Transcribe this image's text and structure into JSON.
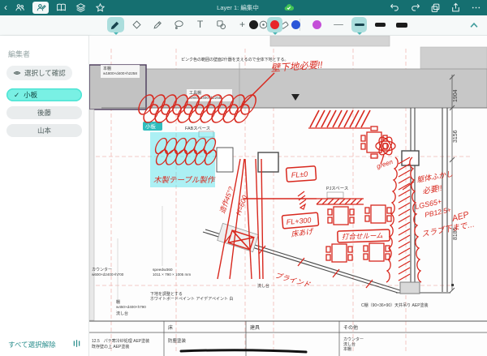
{
  "topbar": {
    "back": "‹",
    "title": "Layer 1: 編集中",
    "icons": [
      "collaborators",
      "editor-mode",
      "notebook",
      "layers",
      "favorite",
      "sync-ok",
      "undo",
      "redo",
      "duplicate",
      "export",
      "more"
    ]
  },
  "toolbar": {
    "tools": [
      "pen",
      "marker",
      "pencil",
      "lasso",
      "text",
      "shape",
      "add",
      "precision",
      "eraser"
    ],
    "selected_tool": "pen",
    "text_tool_label": "T",
    "plus_tool_label": "+",
    "colors": [
      "#1c1c1c",
      "#e8262a",
      "#2b56d8",
      "#c44fd8"
    ],
    "selected_color": "#e8262a",
    "stroke_widths_px": [
      2,
      3,
      5,
      7
    ],
    "selected_stroke_index": 1,
    "accent": "#156f70",
    "highlight_cyan": "#49e0e8"
  },
  "sidebar": {
    "header": "編集者",
    "confirm_button": "選択して確認",
    "members": [
      {
        "name": "小板",
        "selected": true,
        "check": "✓"
      },
      {
        "name": "後藤",
        "selected": false
      },
      {
        "name": "山本",
        "selected": false
      }
    ],
    "deselect_all": "すべて選択解除"
  },
  "canvas": {
    "editor_tag": "小板",
    "dims": {
      "d1": "1904",
      "d2": "3156",
      "d3": "8185"
    },
    "cad": {
      "note": "ピンク色の範囲の壁面2什器を支えるので全体下地とする。",
      "bookshelf": [
        "本棚",
        "w1800×d400×h2258"
      ],
      "toolshelf": [
        "工具棚",
        "w900×d400×h2258"
      ],
      "fab": "FABスペース",
      "pj": "PJスペース",
      "counter": [
        "カウンター",
        "w600×d2400×h700"
      ],
      "machine": [
        "speedw360",
        "1011 × 790 × 1005 mm"
      ],
      "whiteboard": [
        "下地を調整とする",
        "ホワイトボードペイント アイデアペイント 白"
      ],
      "shelf": [
        "棚",
        "w450×d400×h790"
      ],
      "sink1": "流し台",
      "sink2": "流し台",
      "ceiling_shelf": "C棚（90×36×90）天井吊り AEP塗装"
    },
    "red": {
      "kabe": "壁下地必要!!",
      "mokusei": "木製テーブル製作",
      "fl0": "FL±0",
      "fl300": "FL+300",
      "yukaage": "床あげ",
      "meeting": "打合せルーム",
      "green": "green",
      "kutai1": "躯体ふかし",
      "kutai2": "必要!!",
      "lgs": "LGS65+",
      "pb": "PB12.5+",
      "aep": "AEP",
      "slab": "スラブ下まで…",
      "blind": "ブラインド",
      "h600": "H=600",
      "zosaku": "造作45°?"
    },
    "table": {
      "headers": [
        "床",
        "建具",
        "その他"
      ],
      "left_note": [
        "12.5　パテ寒冷紗処理 AEP塗装",
        "既存壁の上 AEP塗装"
      ],
      "floor_cell": "防塵塗装",
      "other_cell": [
        "カウンター",
        "流し台",
        "本棚"
      ]
    }
  }
}
